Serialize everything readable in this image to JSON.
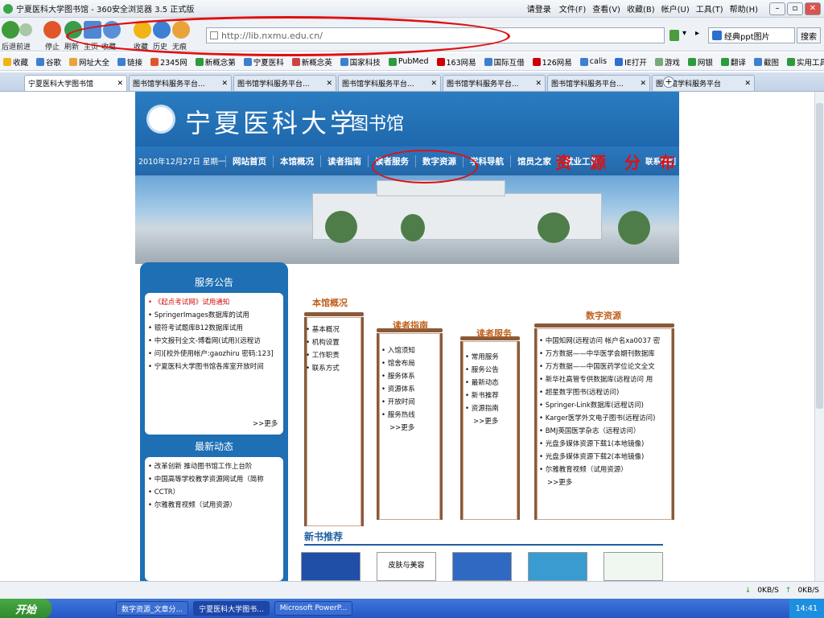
{
  "window": {
    "title": "宁夏医科大学图书馆 - 360安全浏览器 3.5 正式版",
    "login": "请登录",
    "menu": [
      "文件(F)",
      "查看(V)",
      "收藏(B)",
      "帐户(U)",
      "工具(T)",
      "帮助(H)"
    ]
  },
  "toolbar": {
    "labels": [
      "后退",
      "前进",
      "停止",
      "刷新",
      "主页",
      "收藏",
      "收藏",
      "历史",
      "无痕"
    ],
    "address": "http://lib.nxmu.edu.cn/",
    "search_value": "经典ppt图片",
    "search_button": "搜索"
  },
  "favorites": [
    "收藏",
    "谷歌",
    "网址大全",
    "链接",
    "2345网",
    "新概念第",
    "宁夏医科",
    "新概念英",
    "国家科技",
    "PubMed",
    "163网易",
    "国际互借",
    "126网易",
    "calis",
    "IE打开",
    "游戏",
    "网银",
    "翻译",
    "截图",
    "实用工具"
  ],
  "tabs": [
    {
      "label": "宁夏医科大学图书馆",
      "active": true
    },
    {
      "label": "图书馆学科服务平台...",
      "active": false
    },
    {
      "label": "图书馆学科服务平台...",
      "active": false
    },
    {
      "label": "图书馆学科服务平台...",
      "active": false
    },
    {
      "label": "图书馆学科服务平台...",
      "active": false
    },
    {
      "label": "图书馆学科服务平台...",
      "active": false
    },
    {
      "label": "图书馆学科服务平台",
      "active": false
    }
  ],
  "site": {
    "name": "宁夏医科大学",
    "library": "图书馆",
    "date": "2010年12月27日 星期一",
    "nav": [
      "网站首页",
      "本馆概况",
      "读者指南",
      "读者服务",
      "数字资源",
      "学科导航",
      "馆员之家",
      "就业工作"
    ],
    "contact": "联系我们",
    "notice": {
      "title": "服务公告",
      "items": [
        "《起点考试网》试用通知",
        "SpringerImages数据库的试用",
        "银符考试题库B12数据库试用",
        "中文报刊全文-博看网(试用)(远程访",
        "问)[校外使用帐户:gaozhiru 密码:123]",
        "宁夏医科大学图书馆各库室开放时间"
      ],
      "more": ">>更多"
    },
    "news": {
      "title": "最新动态",
      "items": [
        "改革创新 推动图书馆工作上台阶",
        "中国高等学校教学资源网试用（简称",
        "CCTR）",
        "尔雅教育视频（试用资源）"
      ]
    },
    "about": {
      "title": "本馆概况",
      "items": [
        "基本概况",
        "机构设置",
        "工作职责",
        "联系方式"
      ]
    },
    "guide": {
      "title": "读者指南",
      "items": [
        "入馆须知",
        "馆舍布局",
        "服务体系",
        "资源体系",
        "开放时间",
        "服务热线"
      ],
      "more": ">>更多"
    },
    "service": {
      "title": "读者服务",
      "items": [
        "常用服务",
        "服务公告",
        "最新动态",
        "新书推荐",
        "资源指南"
      ],
      "more": ">>更多"
    },
    "digital": {
      "title": "数字资源",
      "items": [
        "中国知网(远程访问 帐户名xa0037 密",
        "万方数据——中华医学会期刊数据库",
        "万方数据——中国医药学位论文全文",
        "新华社高管专供数据库(远程访问 用",
        "超星数字图书(远程访问)",
        "Springer-Link数据库(远程访问)",
        "Karger医学外文电子图书(远程访问)",
        "BMJ英国医学杂志（远程访问）",
        "光盘多媒体资源下载1(本地镜像)",
        "光盘多媒体资源下载2(本地镜像)",
        "尔雅教育视频（试用资源）"
      ],
      "more": ">>更多"
    },
    "newbooks": "新书推荐",
    "book_texts": [
      "",
      "皮肤与美容",
      "",
      "",
      ""
    ]
  },
  "annotation": "资 源 分 布",
  "status": {
    "down": "0KB/S",
    "up": "0KB/S"
  },
  "taskbar": {
    "start": "开始",
    "tasks": [
      "数字资源_文章分...",
      "宁夏医科大学图书...",
      "Microsoft PowerP..."
    ],
    "time": "14:41"
  }
}
